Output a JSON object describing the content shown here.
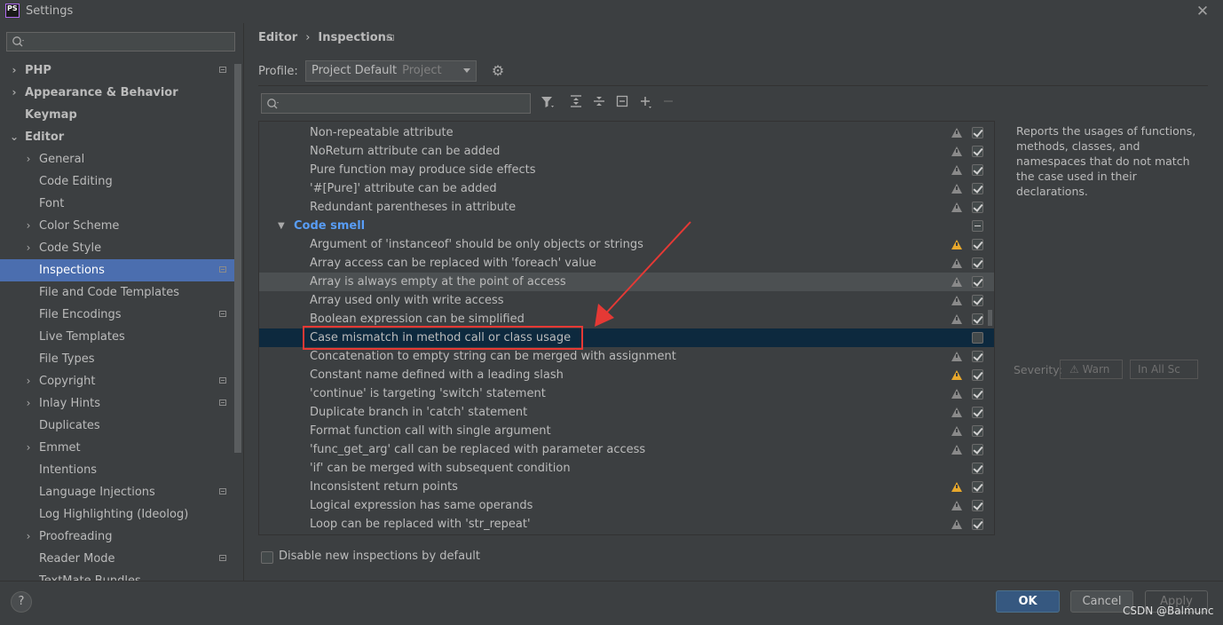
{
  "window": {
    "title": "Settings",
    "logo_text": "PS"
  },
  "left_search": {
    "placeholder": ""
  },
  "sidebar": {
    "items": [
      {
        "label": "PHP"
      },
      {
        "label": "Appearance & Behavior"
      },
      {
        "label": "Keymap"
      },
      {
        "label": "Editor"
      },
      {
        "label": "General"
      },
      {
        "label": "Code Editing"
      },
      {
        "label": "Font"
      },
      {
        "label": "Color Scheme"
      },
      {
        "label": "Code Style"
      },
      {
        "label": "Inspections"
      },
      {
        "label": "File and Code Templates"
      },
      {
        "label": "File Encodings"
      },
      {
        "label": "Live Templates"
      },
      {
        "label": "File Types"
      },
      {
        "label": "Copyright"
      },
      {
        "label": "Inlay Hints"
      },
      {
        "label": "Duplicates"
      },
      {
        "label": "Emmet"
      },
      {
        "label": "Intentions"
      },
      {
        "label": "Language Injections"
      },
      {
        "label": "Log Highlighting (Ideolog)"
      },
      {
        "label": "Proofreading"
      },
      {
        "label": "Reader Mode"
      },
      {
        "label": "TextMate Bundles"
      }
    ]
  },
  "breadcrumb": {
    "parent": "Editor",
    "separator": "›",
    "current": "Inspections"
  },
  "profile": {
    "label": "Profile:",
    "value": "Project Default",
    "scope": "Project"
  },
  "inspection_search": {
    "placeholder": ""
  },
  "inspections": {
    "rows": [
      {
        "name": "Non-repeatable attribute",
        "severity": "weak",
        "checked": true
      },
      {
        "name": "NoReturn attribute can be added",
        "severity": "weak",
        "checked": true
      },
      {
        "name": "Pure function may produce side effects",
        "severity": "weak",
        "checked": true
      },
      {
        "name": "'#[Pure]' attribute can be added",
        "severity": "weak",
        "checked": true
      },
      {
        "name": "Redundant parentheses in attribute",
        "severity": "weak",
        "checked": true
      },
      {
        "name": "Code smell",
        "group": true,
        "state": "mixed"
      },
      {
        "name": "Argument of 'instanceof' should be only objects or strings",
        "severity": "warning",
        "checked": true
      },
      {
        "name": "Array access can be replaced with 'foreach' value",
        "severity": "weak",
        "checked": true
      },
      {
        "name": "Array is always empty at the point of access",
        "severity": "weak",
        "checked": true
      },
      {
        "name": "Array used only with write access",
        "severity": "weak",
        "checked": true
      },
      {
        "name": "Boolean expression can be simplified",
        "severity": "weak",
        "checked": true
      },
      {
        "name": "Case mismatch in method call or class usage",
        "severity": "none",
        "checked": false
      },
      {
        "name": "Concatenation to empty string can be merged with assignment",
        "severity": "weak",
        "checked": true
      },
      {
        "name": "Constant name defined with a leading slash",
        "severity": "warning",
        "checked": true
      },
      {
        "name": "'continue' is targeting 'switch' statement",
        "severity": "weak",
        "checked": true
      },
      {
        "name": "Duplicate branch in 'catch' statement",
        "severity": "weak",
        "checked": true
      },
      {
        "name": "Format function call with single argument",
        "severity": "weak",
        "checked": true
      },
      {
        "name": "'func_get_arg' call can be replaced with parameter access",
        "severity": "weak",
        "checked": true
      },
      {
        "name": "'if' can be merged with subsequent condition",
        "severity": "none",
        "checked": true
      },
      {
        "name": "Inconsistent return points",
        "severity": "warning",
        "checked": true
      },
      {
        "name": "Logical expression has same operands",
        "severity": "weak",
        "checked": true
      },
      {
        "name": "Loop can be replaced with 'str_repeat'",
        "severity": "weak",
        "checked": true
      }
    ]
  },
  "description": {
    "text": "Reports the usages of functions, methods, classes, and namespaces that do not match the case used in their declarations."
  },
  "severity": {
    "label": "Severity:",
    "value": "⚠ Warn",
    "scope": "In All Sc"
  },
  "disable_new": {
    "label": "Disable new inspections by default",
    "checked": false
  },
  "footer": {
    "help": "?",
    "ok": "OK",
    "cancel": "Cancel",
    "apply": "Apply"
  },
  "watermark": "CSDN @Balmunc",
  "colors": {
    "selection": "#4b6eaf",
    "highlight_box": "#e53935",
    "group": "#589df6",
    "ok_button": "#365880"
  }
}
